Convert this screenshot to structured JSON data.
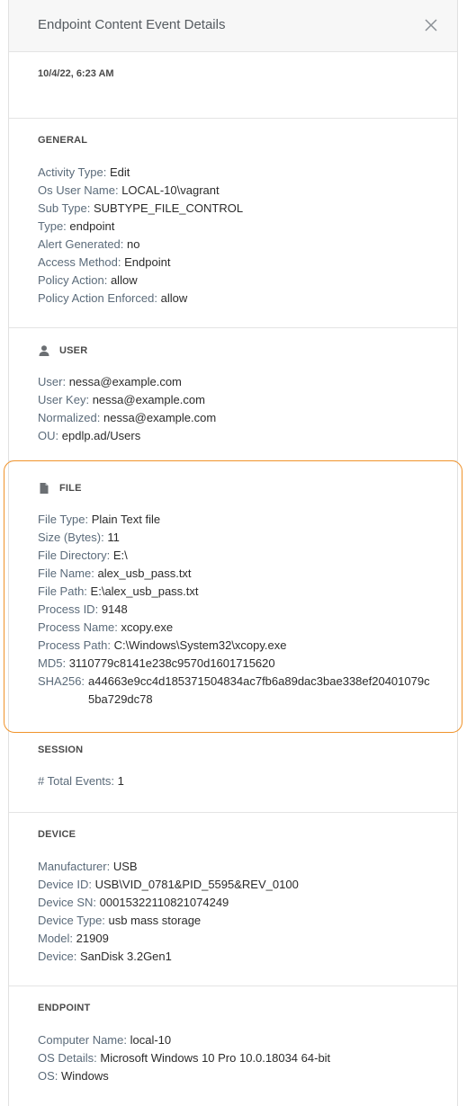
{
  "header": {
    "title": "Endpoint Content Event Details",
    "close_icon": "close-icon"
  },
  "event": {
    "date": "10/4/22, 6:23 AM"
  },
  "general": {
    "title": "GENERAL",
    "rows": [
      {
        "key": "Activity Type:",
        "value": "Edit"
      },
      {
        "key": "Os User Name:",
        "value": "LOCAL-10\\vagrant"
      },
      {
        "key": "Sub Type:",
        "value": "SUBTYPE_FILE_CONTROL"
      },
      {
        "key": "Type:",
        "value": "endpoint"
      },
      {
        "key": "Alert Generated:",
        "value": "no"
      },
      {
        "key": "Access Method:",
        "value": "Endpoint"
      },
      {
        "key": "Policy Action:",
        "value": "allow"
      },
      {
        "key": "Policy Action Enforced:",
        "value": "allow"
      }
    ]
  },
  "user": {
    "title": "USER",
    "icon": "user-icon",
    "rows": [
      {
        "key": "User:",
        "value": "nessa@example.com"
      },
      {
        "key": "User Key:",
        "value": "nessa@example.com"
      },
      {
        "key": "Normalized:",
        "value": "nessa@example.com"
      },
      {
        "key": "OU:",
        "value": "epdlp.ad/Users"
      }
    ]
  },
  "file": {
    "title": "FILE",
    "icon": "file-icon",
    "highlight_color": "#f0932b",
    "rows": [
      {
        "key": "File Type:",
        "value": "Plain Text file"
      },
      {
        "key": "Size (Bytes):",
        "value": "11"
      },
      {
        "key": "File Directory:",
        "value": "E:\\"
      },
      {
        "key": "File Name:",
        "value": "alex_usb_pass.txt"
      },
      {
        "key": "File Path:",
        "value": "E:\\alex_usb_pass.txt"
      },
      {
        "key": "Process ID:",
        "value": "9148"
      },
      {
        "key": "Process Name:",
        "value": "xcopy.exe"
      },
      {
        "key": "Process Path:",
        "value": "C:\\Windows\\System32\\xcopy.exe"
      },
      {
        "key": "MD5:",
        "value": "3110779c8141e238c9570d1601715620"
      }
    ],
    "sha256": {
      "key": "SHA256:",
      "value": "a44663e9cc4d185371504834ac7fb6a89dac3bae338ef20401079c5ba729dc78"
    }
  },
  "session": {
    "title": "SESSION",
    "rows": [
      {
        "key": "# Total Events:",
        "value": "1"
      }
    ]
  },
  "device": {
    "title": "DEVICE",
    "rows": [
      {
        "key": "Manufacturer:",
        "value": "USB"
      },
      {
        "key": "Device ID:",
        "value": "USB\\VID_0781&PID_5595&REV_0100"
      },
      {
        "key": "Device SN:",
        "value": "00015322110821074249"
      },
      {
        "key": "Device Type:",
        "value": "usb mass storage"
      },
      {
        "key": "Model:",
        "value": "21909"
      },
      {
        "key": "Device:",
        "value": "SanDisk 3.2Gen1"
      }
    ]
  },
  "endpoint": {
    "title": "ENDPOINT",
    "rows": [
      {
        "key": "Computer Name:",
        "value": "local-10"
      },
      {
        "key": "OS Details:",
        "value": "Microsoft Windows 10 Pro 10.0.18034 64-bit"
      },
      {
        "key": "OS:",
        "value": "Windows"
      }
    ]
  }
}
